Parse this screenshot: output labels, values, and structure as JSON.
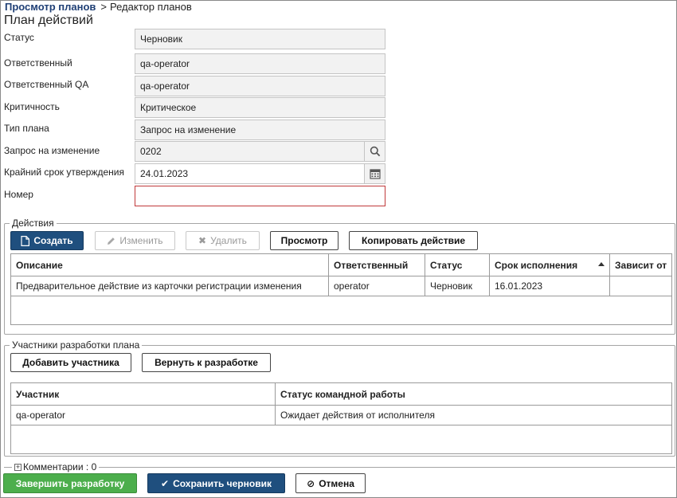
{
  "breadcrumb": {
    "link": "Просмотр планов",
    "separator": ">",
    "current": "Редактор планов"
  },
  "page_title": "План действий",
  "form": {
    "status": {
      "label": "Статус",
      "value": "Черновик"
    },
    "responsible": {
      "label": "Ответственный",
      "value": "qa-operator"
    },
    "responsible_qa": {
      "label": "Ответственный QA",
      "value": "qa-operator"
    },
    "criticality": {
      "label": "Критичность",
      "value": "Критическое"
    },
    "plan_type": {
      "label": "Тип плана",
      "value": "Запрос на изменение"
    },
    "change_request": {
      "label": "Запрос на изменение",
      "value": "0202"
    },
    "approval_deadline": {
      "label": "Крайний срок утверждения",
      "value": "24.01.2023"
    },
    "number": {
      "label": "Номер",
      "value": ""
    }
  },
  "actions": {
    "legend": "Действия",
    "buttons": {
      "create": "Создать",
      "edit": "Изменить",
      "delete": "Удалить",
      "view": "Просмотр",
      "copy": "Копировать действие"
    },
    "columns": [
      "Описание",
      "Ответственный",
      "Статус",
      "Срок исполнения",
      "Зависит от"
    ],
    "rows": [
      [
        "Предварительное действие из карточки регистрации изменения",
        "operator",
        "Черновик",
        "16.01.2023",
        ""
      ]
    ]
  },
  "participants": {
    "legend": "Участники разработки плана",
    "buttons": {
      "add": "Добавить участника",
      "return": "Вернуть к разработке"
    },
    "columns": [
      "Участник",
      "Статус командной работы"
    ],
    "rows": [
      [
        "qa-operator",
        "Ожидает действия от исполнителя"
      ]
    ]
  },
  "comments": {
    "label": "Комментарии : 0"
  },
  "footer": {
    "finish": "Завершить разработку",
    "save": "Сохранить черновик",
    "cancel": "Отмена"
  },
  "colors": {
    "primary": "#1f4f7e",
    "success": "#4cae4c",
    "link": "#1f3f75",
    "error": "#c0393b"
  }
}
